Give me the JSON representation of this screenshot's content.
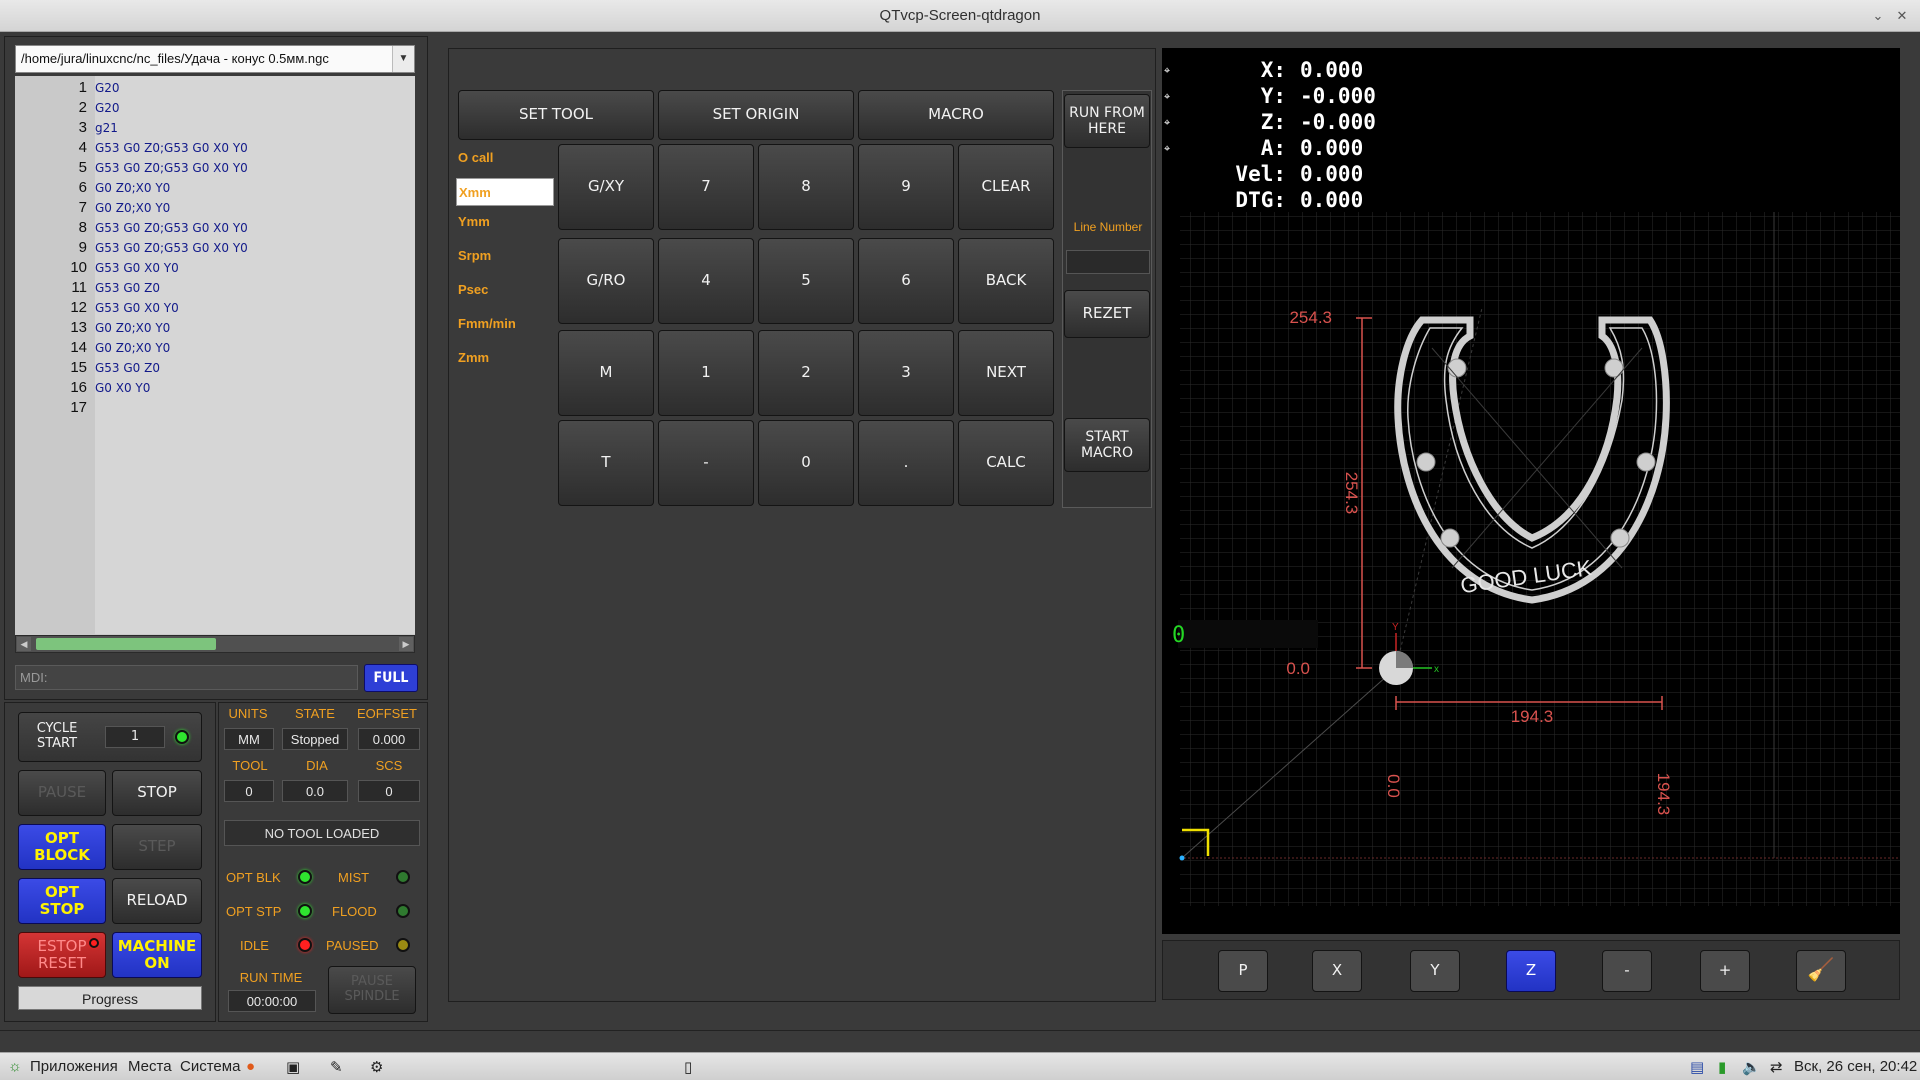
{
  "window": {
    "title": "QTvcp-Screen-qtdragon"
  },
  "file": {
    "path": "/home/jura/linuxcnc/nc_files/Удача - конус 0.5мм.ngc"
  },
  "gcode": [
    {
      "n": "1",
      "t": "G20"
    },
    {
      "n": "2",
      "t": "G20"
    },
    {
      "n": "3",
      "t": "g21"
    },
    {
      "n": "4",
      "t": "G53 G0 Z0;G53 G0 X0 Y0"
    },
    {
      "n": "5",
      "t": "G53 G0 Z0;G53 G0 X0 Y0"
    },
    {
      "n": "6",
      "t": "G0 Z0;X0 Y0"
    },
    {
      "n": "7",
      "t": "G0 Z0;X0 Y0"
    },
    {
      "n": "8",
      "t": "G53 G0 Z0;G53 G0 X0 Y0"
    },
    {
      "n": "9",
      "t": "G53 G0 Z0;G53 G0 X0 Y0"
    },
    {
      "n": "10",
      "t": "G53 G0 X0 Y0"
    },
    {
      "n": "11",
      "t": "G53 G0 Z0"
    },
    {
      "n": "12",
      "t": "G53 G0 X0 Y0"
    },
    {
      "n": "13",
      "t": "G0 Z0;X0 Y0"
    },
    {
      "n": "14",
      "t": "G0 Z0;X0 Y0"
    },
    {
      "n": "15",
      "t": "G53 G0 Z0"
    },
    {
      "n": "16",
      "t": " G0 X0 Y0"
    },
    {
      "n": "17",
      "t": ""
    }
  ],
  "mdi": {
    "placeholder": "MDI:",
    "full_label": "FULL"
  },
  "controls": {
    "cycle_start": "CYCLE\nSTART",
    "cycle_count": "1",
    "pause": "PAUSE",
    "stop": "STOP",
    "opt_block": "OPT\nBLOCK",
    "step": "STEP",
    "opt_stop": "OPT\nSTOP",
    "reload": "RELOAD",
    "estop": "ESTOP\nRESET",
    "machine_on": "MACHINE\nON",
    "progress": "Progress"
  },
  "status": {
    "units_label": "UNITS",
    "state_label": "STATE",
    "eoffset_label": "EOFFSET",
    "units": "MM",
    "state": "Stopped",
    "eoffset": "0.000",
    "tool_label": "TOOL",
    "dia_label": "DIA",
    "scs_label": "SCS",
    "tool": "0",
    "dia": "0.0",
    "scs": "0",
    "tool_loaded": "NO TOOL LOADED",
    "opt_blk": "OPT BLK",
    "mist": "MIST",
    "opt_stp": "OPT STP",
    "flood": "FLOOD",
    "idle": "IDLE",
    "paused": "PAUSED",
    "run_time_label": "RUN TIME",
    "run_time": "00:00:00",
    "pause_spindle": "PAUSE\nSPINDLE"
  },
  "macro_panel": {
    "set_tool": "SET TOOL",
    "set_origin": "SET ORIGIN",
    "macro": "MACRO",
    "run_from_here": "RUN FROM\nHERE",
    "line_number_label": "Line Number",
    "rezet": "REZET",
    "start_macro": "START\nMACRO",
    "params": [
      "O call",
      "Xmm",
      "Ymm",
      "Srpm",
      "Psec",
      "Fmm/min",
      "Zmm"
    ],
    "keypad": [
      [
        "G/XY",
        "7",
        "8",
        "9",
        "CLEAR"
      ],
      [
        "G/RO",
        "4",
        "5",
        "6",
        "BACK"
      ],
      [
        "M",
        "1",
        "2",
        "3",
        "NEXT"
      ],
      [
        "T",
        "-",
        "0",
        ".",
        "CALC"
      ]
    ]
  },
  "dro": [
    {
      "axis": "X:",
      "value": "0.000"
    },
    {
      "axis": "Y:",
      "value": "-0.000"
    },
    {
      "axis": "Z:",
      "value": "-0.000"
    },
    {
      "axis": "A:",
      "value": "0.000"
    },
    {
      "axis": "Vel:",
      "value": "0.000"
    },
    {
      "axis": "DTG:",
      "value": "0.000"
    }
  ],
  "preview": {
    "dim_y_top": "254.3",
    "dim_y_side": "254.3",
    "dim_zero_y": "0.0",
    "dim_x": "194.3",
    "dim_zero_x": "0.0",
    "dim_x_side": "194.3",
    "engraving": "GOOD LUCK",
    "g_code_line": "0",
    "axis_x": "x",
    "axis_y": "Y"
  },
  "view_buttons": [
    "P",
    "X",
    "Y",
    "Z",
    "-",
    "+"
  ],
  "taskbar": {
    "apps": "Приложения",
    "places": "Места",
    "system": "Система",
    "clock": "Вск, 26 сен, 20:42"
  },
  "colors": {
    "accent_blue": "#2e3fd6",
    "label_orange": "#f0a021",
    "dim_red": "#d9524e",
    "grid": "#2b2b2b"
  }
}
